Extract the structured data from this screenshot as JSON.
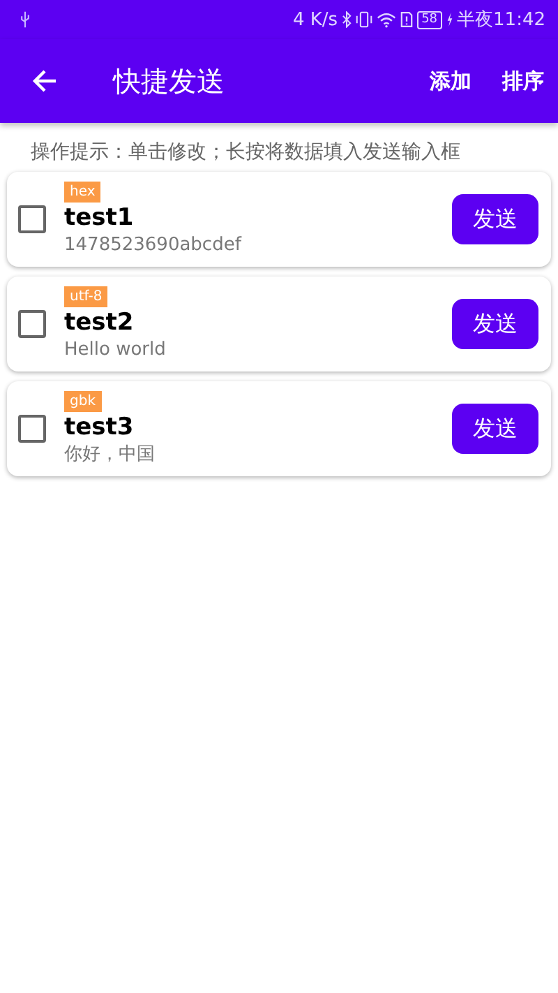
{
  "status_bar": {
    "speed": "4 K/s",
    "battery": "58",
    "time": "半夜11:42"
  },
  "app_bar": {
    "title": "快捷发送",
    "actions": [
      "添加",
      "排序"
    ]
  },
  "hint": "操作提示：单击修改；长按将数据填入发送输入框",
  "items": [
    {
      "encoding": "hex",
      "name": "test1",
      "data": "1478523690abcdef",
      "checked": false,
      "button": "发送"
    },
    {
      "encoding": "utf-8",
      "name": "test2",
      "data": "Hello world",
      "checked": false,
      "button": "发送"
    },
    {
      "encoding": "gbk",
      "name": "test3",
      "data": "你好，中国",
      "checked": false,
      "button": "发送"
    }
  ]
}
